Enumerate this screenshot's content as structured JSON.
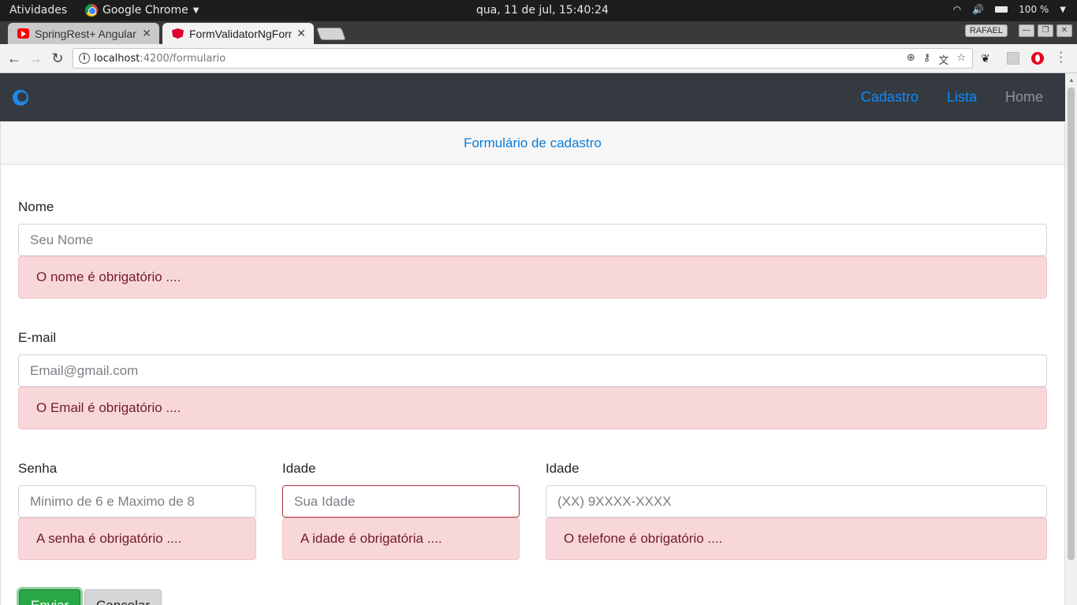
{
  "os_bar": {
    "activities": "Atividades",
    "app_name": "Google Chrome",
    "clock": "qua, 11 de jul, 15:40:24",
    "battery_label": "100 %"
  },
  "tabs": [
    {
      "label": "SpringRest+ Angular",
      "icon": "youtube-icon",
      "active": false
    },
    {
      "label": "FormValidatorNgForm",
      "icon": "angular-icon",
      "active": true
    }
  ],
  "window": {
    "profile": "RAFAEL"
  },
  "address_bar": {
    "host": "localhost",
    "path": ":4200/formulario"
  },
  "app_nav": {
    "links": [
      "Cadastro",
      "Lista",
      "Home"
    ]
  },
  "form": {
    "header": "Formulário de cadastro",
    "nome": {
      "label": "Nome",
      "placeholder": "Seu Nome",
      "error": "O nome é obrigatório ...."
    },
    "email": {
      "label": "E-mail",
      "placeholder": "Email@gmail.com",
      "error": "O Email é obrigatório ...."
    },
    "senha": {
      "label": "Senha",
      "placeholder": "Minimo de 6 e Maximo de  8",
      "error": "A senha é obrigatório ...."
    },
    "idade": {
      "label": "Idade",
      "placeholder": "Sua Idade",
      "error": "A idade é obrigatória ...."
    },
    "telefone": {
      "label": "Idade",
      "placeholder": "(XX) 9XXXX-XXXX",
      "error": "O telefone é obrigatório ...."
    },
    "submit_label": "Enviar",
    "cancel_label": "Cancelar"
  },
  "colors": {
    "navbar": "#343a40",
    "link_active": "#0d8bff",
    "alert_bg": "#f8d7da",
    "alert_text": "#721c24",
    "submit": "#28a745"
  }
}
